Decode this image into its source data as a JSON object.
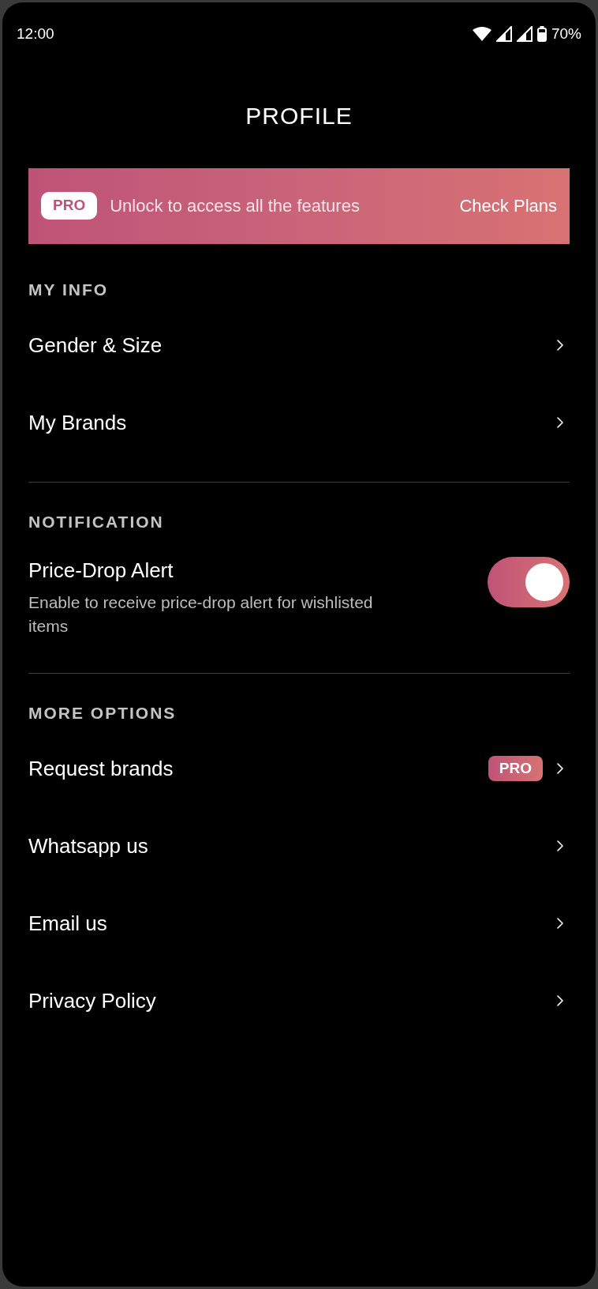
{
  "status_bar": {
    "time": "12:00",
    "battery": "70%"
  },
  "title": "PROFILE",
  "banner": {
    "badge": "PRO",
    "text": "Unlock to access all the features",
    "action": "Check Plans"
  },
  "sections": [
    {
      "title": "MY INFO",
      "items": [
        {
          "kind": "nav",
          "label": "Gender & Size"
        },
        {
          "kind": "nav",
          "label": "My Brands"
        }
      ]
    },
    {
      "title": "NOTIFICATION",
      "items": [
        {
          "kind": "toggle",
          "label": "Price-Drop Alert",
          "description": "Enable to receive price-drop alert for wishlisted items",
          "on": true
        }
      ]
    },
    {
      "title": "MORE OPTIONS",
      "items": [
        {
          "kind": "nav",
          "label": "Request brands",
          "badge": "PRO"
        },
        {
          "kind": "nav",
          "label": "Whatsapp us"
        },
        {
          "kind": "nav",
          "label": "Email us"
        },
        {
          "kind": "nav",
          "label": "Privacy Policy"
        }
      ]
    }
  ]
}
